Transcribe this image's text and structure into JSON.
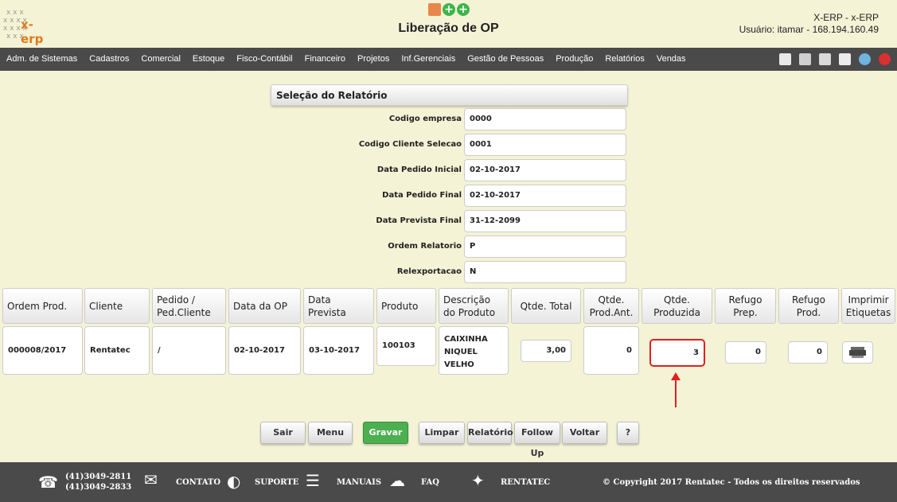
{
  "header": {
    "logo_text": "x-erp",
    "title": "Liberação de OP",
    "system_line": "X-ERP - x-ERP",
    "user_line": "Usuário: itamar - 168.194.160.49"
  },
  "menu": {
    "items": [
      "Adm. de Sistemas",
      "Cadastros",
      "Comercial",
      "Estoque",
      "Fisco-Contábil",
      "Financeiro",
      "Projetos",
      "Inf.Gerenciais",
      "Gestão de Pessoas",
      "Produção",
      "Relatórios",
      "Vendas"
    ],
    "icons": [
      "home-icon",
      "printer-icon",
      "document-icon",
      "report-icon",
      "globe-icon",
      "power-icon"
    ]
  },
  "form": {
    "section_title": "Seleção do Relatório",
    "fields": [
      {
        "label": "Codigo empresa",
        "value": "0000"
      },
      {
        "label": "Codigo Cliente Selecao",
        "value": "0001"
      },
      {
        "label": "Data Pedido Inicial",
        "value": "02-10-2017"
      },
      {
        "label": "Data Pedido Final",
        "value": "02-10-2017"
      },
      {
        "label": "Data Prevista Final",
        "value": "31-12-2099"
      },
      {
        "label": "Ordem Relatorio",
        "value": "P"
      },
      {
        "label": "Relexportacao",
        "value": "N"
      }
    ]
  },
  "table": {
    "headers": [
      "Ordem Prod.",
      "Cliente",
      "Pedido / Ped.Cliente",
      "Data da OP",
      "Data Prevista",
      "Produto",
      "Descrição do Produto",
      "Qtde. Total",
      "Qtde. Prod.Ant.",
      "Qtde. Produzida",
      "Refugo Prep.",
      "Refugo Prod.",
      "Imprimir Etiquetas"
    ],
    "row": {
      "ordem_prod": "000008/2017",
      "cliente": "Rentatec",
      "pedido": "/",
      "data_op": "02-10-2017",
      "data_prevista": "03-10-2017",
      "produto": "100103",
      "descricao": "CAIXINHA NIQUEL VELHO",
      "qtde_total": "3,00",
      "qtde_prod_ant": "0",
      "qtde_produzida": "3",
      "refugo_prep": "0",
      "refugo_prod": "0"
    }
  },
  "buttons": {
    "sair": "Sair",
    "menu": "Menu",
    "gravar": "Gravar",
    "limpar": "Limpar",
    "relatorio": "Relatório",
    "follow_up": "Follow Up",
    "voltar": "Voltar",
    "help": "?"
  },
  "footer": {
    "phone1": "(41)3049-2811",
    "phone2": "(41)3049-2833",
    "contato": "CONTATO",
    "suporte": "SUPORTE",
    "manuais": "MANUAIS",
    "faq": "FAQ",
    "rentatec": "RENTATEC",
    "copyright": "© Copyright 2017 Rentatec - Todos os direitos reservados"
  },
  "colors": {
    "background": "#f5f3d6",
    "bars": "#4a4a4a",
    "gravar": "#4caf50",
    "highlight": "#e02020"
  }
}
